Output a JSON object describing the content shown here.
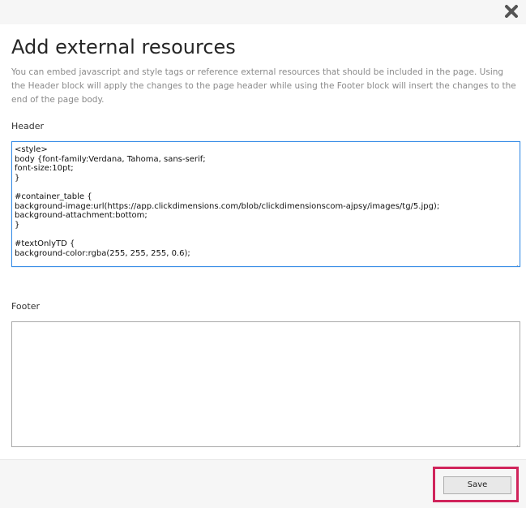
{
  "dialog": {
    "title": "Add external resources",
    "description": "You can embed javascript and style tags or reference external resources that should be included in the page. Using the Header block will apply the changes to the page header while using the Footer block will insert the changes to the end of the page body.",
    "close_icon": "close-x-icon"
  },
  "header": {
    "label": "Header",
    "value": "<style>\nbody {font-family:Verdana, Tahoma, sans-serif;\nfont-size:10pt;\n}\n\n#container_table {\nbackground-image:url(https://app.clickdimensions.com/blob/clickdimensionscom-ajpsy/images/tg/5.jpg);\nbackground-attachment:bottom;\n}\n\n#textOnlyTD {\nbackground-color:rgba(255, 255, 255, 0.6);"
  },
  "footer": {
    "label": "Footer",
    "value": ""
  },
  "actions": {
    "save_label": "Save"
  },
  "colors": {
    "highlight": "#d0245b",
    "focus_border": "#3a8ee6"
  }
}
